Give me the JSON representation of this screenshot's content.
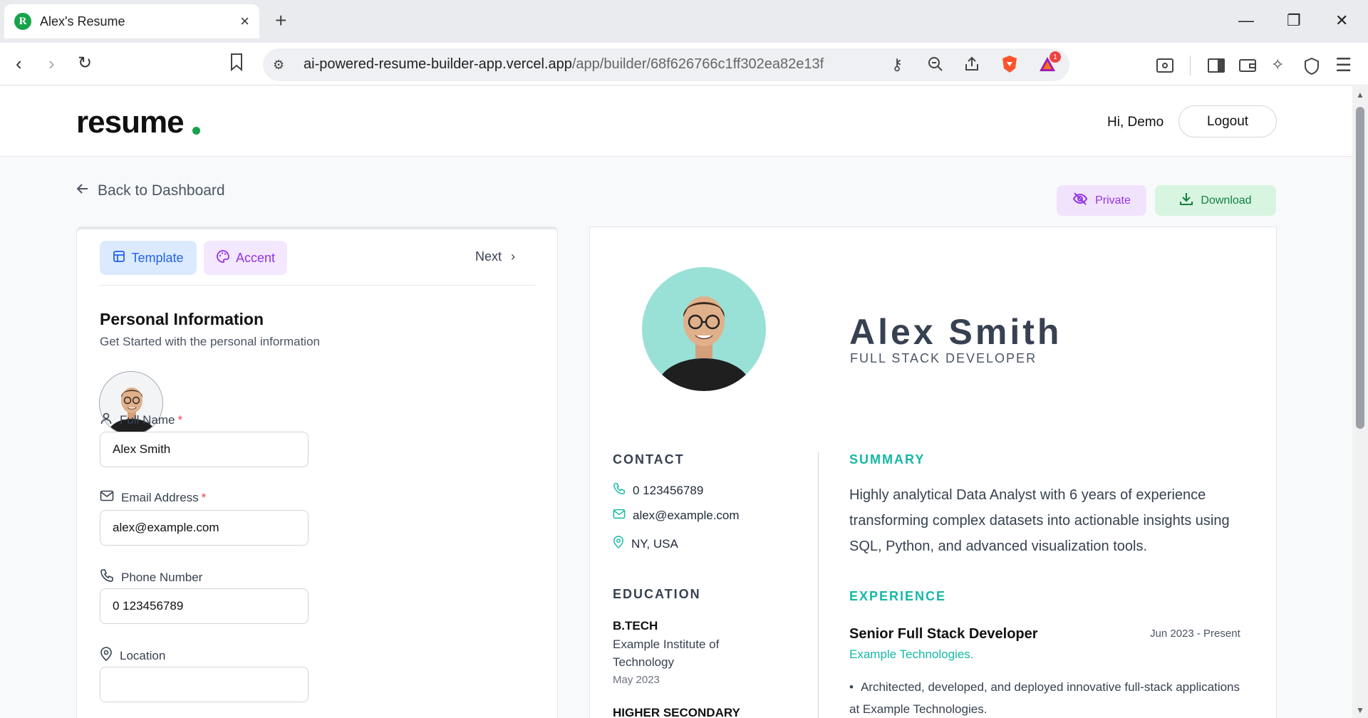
{
  "browser": {
    "tab_title": "Alex's Resume",
    "tab_close": "×",
    "new_tab": "+",
    "url_domain": "ai-powered-resume-builder-app.vercel.app",
    "url_path": "/app/builder/68f626766c1ff302ea82e13f",
    "notification_count": "1"
  },
  "header": {
    "logo": "resume",
    "greeting": "Hi, Demo",
    "logout_label": "Logout"
  },
  "toolbar": {
    "back_label": "Back to Dashboard",
    "private_label": "Private",
    "download_label": "Download"
  },
  "editor": {
    "tabs": [
      {
        "label": "Template"
      },
      {
        "label": "Accent"
      }
    ],
    "next_label": "Next",
    "section_title": "Personal Information",
    "section_subtitle": "Get Started with the personal information",
    "fields": {
      "full_name": {
        "label": "Full Name",
        "value": "Alex Smith",
        "required": "*"
      },
      "email": {
        "label": "Email Address",
        "value": "alex@example.com",
        "required": "*"
      },
      "phone": {
        "label": "Phone Number",
        "value": "0 123456789"
      },
      "location": {
        "label": "Location"
      }
    }
  },
  "resume": {
    "name": "Alex Smith",
    "role": "FULL STACK DEVELOPER",
    "contact_heading": "CONTACT",
    "contact": {
      "phone": "0 123456789",
      "email": "alex@example.com",
      "location": "NY, USA"
    },
    "education_heading": "EDUCATION",
    "education": [
      {
        "degree": "B.TECH",
        "school_line1": "Example Institute of",
        "school_line2": "Technology",
        "date": "May 2023"
      },
      {
        "degree": "HIGHER SECONDARY"
      }
    ],
    "summary_heading": "SUMMARY",
    "summary": "Highly analytical Data Analyst with 6 years of experience transforming complex datasets into actionable insights using SQL, Python, and advanced visualization tools.",
    "experience_heading": "EXPERIENCE",
    "experience": [
      {
        "title": "Senior Full Stack Developer",
        "dates": "Jun 2023 - Present",
        "company": "Example Technologies.",
        "bullet": "Architected, developed, and deployed innovative full-stack applications at Example Technologies."
      }
    ]
  },
  "colors": {
    "accent_teal": "#14b8a6",
    "brand_green": "#16a34a",
    "template_blue": "#2563eb",
    "accent_purple": "#9333ea"
  }
}
